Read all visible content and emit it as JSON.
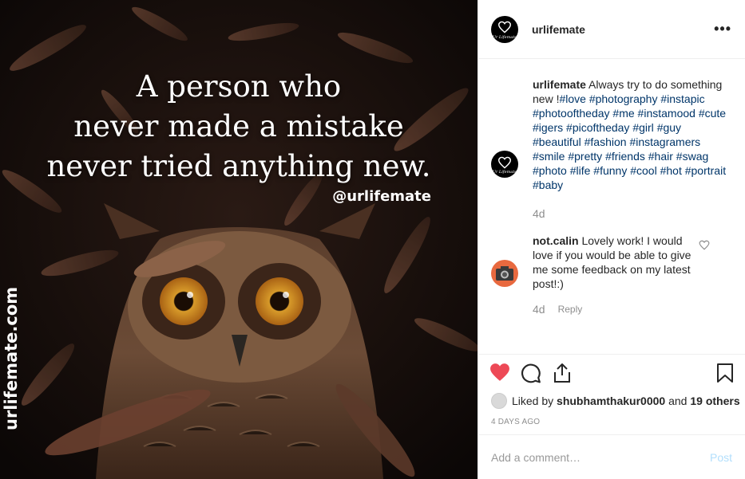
{
  "media": {
    "quote_lines": [
      "A person who",
      "never made a mistake",
      "never tried anything new."
    ],
    "handle": "@urlifemate",
    "site": "urlifemate.com"
  },
  "header": {
    "username": "urlifemate",
    "more_icon": "more-horizontal-icon",
    "avatar_text": "Ur Lifemate"
  },
  "caption": {
    "username": "urlifemate",
    "text": "Always try to do something new !",
    "hashtags": [
      "#love",
      "#photography",
      "#instapic",
      "#photooftheday",
      "#me",
      "#instamood",
      "#cute",
      "#igers",
      "#picoftheday",
      "#girl",
      "#guy",
      "#beautiful",
      "#fashion",
      "#instagramers",
      "#smile",
      "#pretty",
      "#friends",
      "#hair",
      "#swag",
      "#photo",
      "#life",
      "#funny",
      "#cool",
      "#hot",
      "#portrait",
      "#baby"
    ],
    "time": "4d"
  },
  "comment": {
    "username": "not.calin",
    "text": "Lovely work! I would love if you would be able to give me some feedback on my latest post!:)",
    "time": "4d",
    "reply_label": "Reply"
  },
  "actions": {
    "liked_prefix": "Liked by",
    "liked_user": "shubhamthakur0000",
    "liked_and": "and",
    "liked_others": "19 others",
    "date": "4 DAYS AGO"
  },
  "add_comment": {
    "placeholder": "Add a comment…",
    "post_label": "Post"
  },
  "colors": {
    "like_red": "#ed4956",
    "link_blue": "#003569",
    "post_disabled": "#b2dffc"
  }
}
